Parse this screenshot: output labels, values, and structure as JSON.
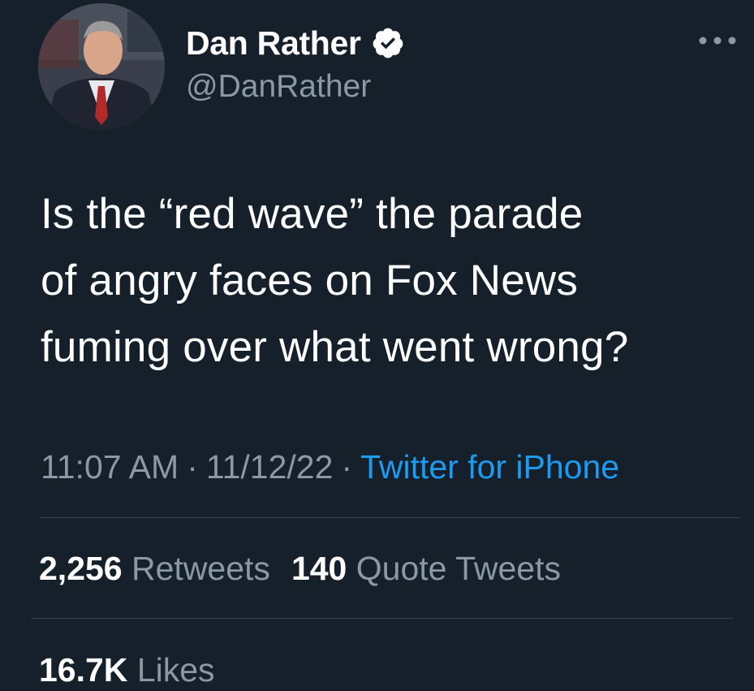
{
  "author": {
    "display_name": "Dan Rather",
    "handle": "@DanRather",
    "verified": true,
    "avatar_icon": "profile-photo"
  },
  "tweet": {
    "text": "Is the “red wave” the parade\nof angry faces on Fox News\nfuming over what went wrong?",
    "time": "11:07 AM",
    "date": "11/12/22",
    "separator": "·",
    "source": "Twitter for iPhone"
  },
  "stats": {
    "retweets_count": "2,256",
    "retweets_label": "Retweets",
    "quotes_count": "140",
    "quotes_label": "Quote Tweets",
    "likes_count": "16.7K",
    "likes_label": "Likes"
  },
  "colors": {
    "background": "#15202b",
    "secondary_text": "#8b98a5",
    "link": "#1d9bf0",
    "divider": "#38444d"
  }
}
